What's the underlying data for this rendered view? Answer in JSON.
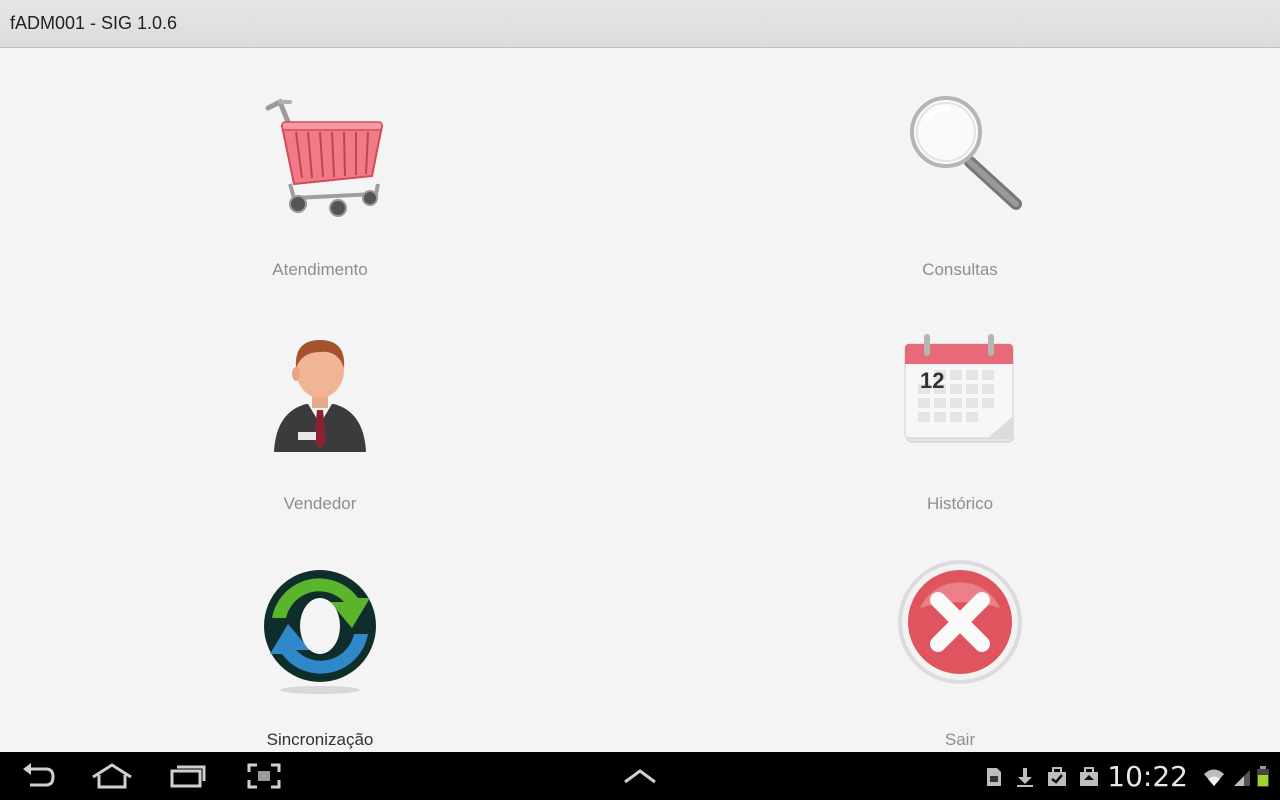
{
  "window": {
    "title": "fADM001 - SIG 1.0.6"
  },
  "menu": [
    {
      "label": "Atendimento",
      "icon": "shopping-cart-icon"
    },
    {
      "label": "Consultas",
      "icon": "magnifier-icon"
    },
    {
      "label": "Vendedor",
      "icon": "salesman-icon"
    },
    {
      "label": "Histórico",
      "icon": "calendar-icon",
      "calendar_day": "12"
    },
    {
      "label": "Sincronização",
      "icon": "sync-icon"
    },
    {
      "label": "Sair",
      "icon": "close-icon"
    }
  ],
  "statusbar": {
    "clock": "10:22"
  },
  "colors": {
    "accent_red": "#e05a63",
    "titlebar": "#dcdcdc",
    "navbar": "#000000"
  }
}
